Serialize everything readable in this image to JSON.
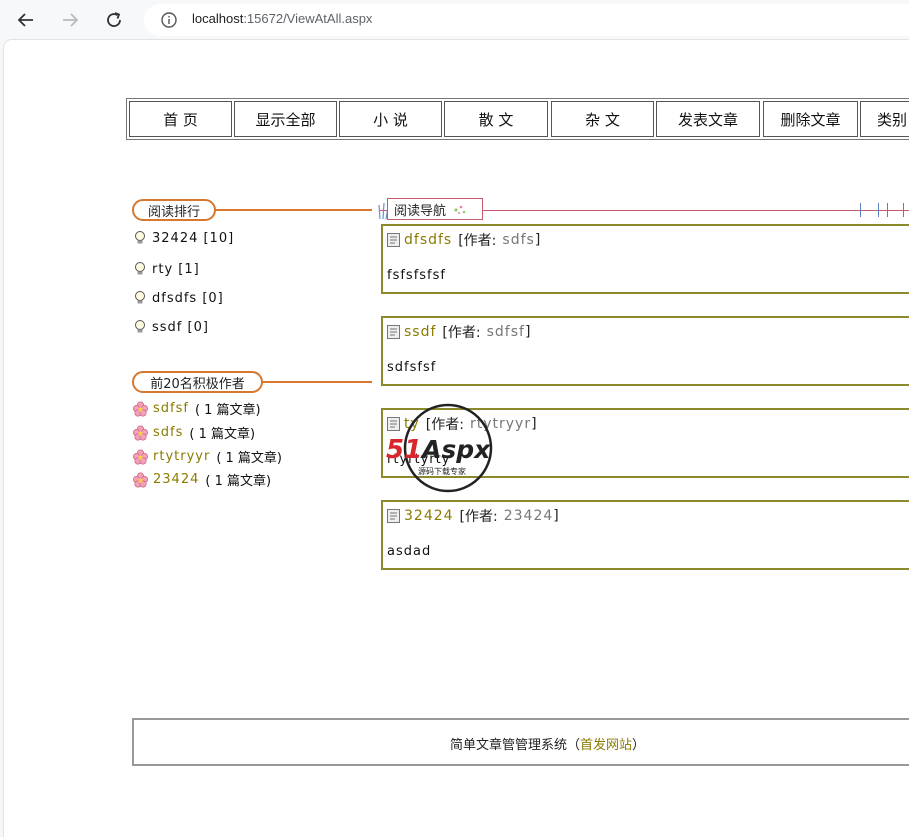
{
  "browser": {
    "url_host": "localhost",
    "url_rest": ":15672/ViewAtAll.aspx",
    "icons": [
      "back-arrow-icon",
      "forward-arrow-icon",
      "reload-icon",
      "info-icon"
    ]
  },
  "nav": {
    "items": [
      "首 页",
      "显示全部",
      "小 说",
      "散 文",
      "杂 文",
      "发表文章",
      "删除文章",
      "类别"
    ]
  },
  "ranking": {
    "title": "阅读排行",
    "items": [
      {
        "label": "32424 [10]"
      },
      {
        "label": "rty [1]"
      },
      {
        "label": "dfsdfs [0]"
      },
      {
        "label": "ssdf [0]"
      }
    ]
  },
  "authors": {
    "title": "前20名积极作者",
    "items": [
      {
        "name": "sdfsf",
        "count": "( 1 篇文章)"
      },
      {
        "name": "sdfs",
        "count": "( 1 篇文章)"
      },
      {
        "name": "rtytryyr",
        "count": "( 1 篇文章)"
      },
      {
        "name": "23424",
        "count": "( 1 篇文章)"
      }
    ]
  },
  "read_nav": {
    "title": "阅读导航"
  },
  "articles": [
    {
      "title": "dfsdfs",
      "author_label": "[作者:",
      "author": "sdfs",
      "close": "]",
      "body": "fsfsfsfsf"
    },
    {
      "title": "ssdf",
      "author_label": "[作者:",
      "author": "sdfsf",
      "close": "]",
      "body": "sdfsfsf"
    },
    {
      "title": "ty",
      "author_label": "[作者:",
      "author": "rtytryyr",
      "close": "]",
      "body": "rtyrtyrty"
    },
    {
      "title": "32424",
      "author_label": "[作者:",
      "author": "23424",
      "close": "]",
      "body": "asdad"
    }
  ],
  "watermark": {
    "brand": "51Aspx",
    "tagline": "源码下载专家"
  },
  "footer": {
    "text": "简单文章管管理系统（",
    "link": "首发网站",
    "end": "）"
  },
  "colors": {
    "orange": "#d7782e",
    "olive": "#8a7b00",
    "border_olive": "#8a8a2a",
    "pink": "#c55a6e"
  }
}
